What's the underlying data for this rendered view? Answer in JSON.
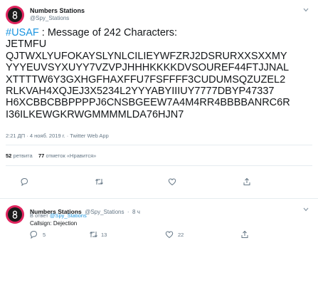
{
  "tweet": {
    "author_name": "Numbers Stations",
    "author_handle": "@Spy_Stations",
    "hashtag": "#USAF",
    "text_rest": " : Message of 242 Characters:",
    "lines": [
      "JETMFU",
      "QJTWXLYUFOKAYSLYNLCILIEYWFZRJ2DSRURXXSXXMY",
      "YYYEUVSYXUYY7VZVPJHHHKKKKDVSOUREF44FTJJNAL",
      "XTTTTW6Y3GXHGFHAXFFU7FSFFFF3CUDUMSQZUZEL2",
      "RLKVAH4XQJEJ3X5234L2YYYABYIIIUY7777DBYP47337",
      "H6XCBBCBBPPPPJ6CNSBGEEW7A4M4RR4BBBBANRC6R",
      "I36ILKEWGKRWGMMMMLDA76HJN7"
    ],
    "time": "2:21 ДП",
    "date": "4 нояб. 2019 г.",
    "source": "Twitter Web App",
    "retweets_count": "52",
    "retweets_label": "ретвита",
    "likes_count": "77",
    "likes_label": "отметок «Нравится»"
  },
  "reply": {
    "author_name": "Numbers Stations",
    "author_handle": "@Spy_Stations",
    "age": "8 ч",
    "in_reply_prefix": "В ответ",
    "in_reply_mention": "@Spy_Stations",
    "body": "Callsign: Dejection",
    "reply_count": "5",
    "retweet_count": "13",
    "like_count": "22"
  },
  "icons": {
    "chevron": "chevron-down-icon",
    "reply": "reply-icon",
    "retweet": "retweet-icon",
    "like": "heart-icon",
    "share": "share-icon"
  },
  "colors": {
    "hashtag": "#1b95e0",
    "avatar_ring": "#e0245e",
    "secondary_text": "#657786"
  }
}
